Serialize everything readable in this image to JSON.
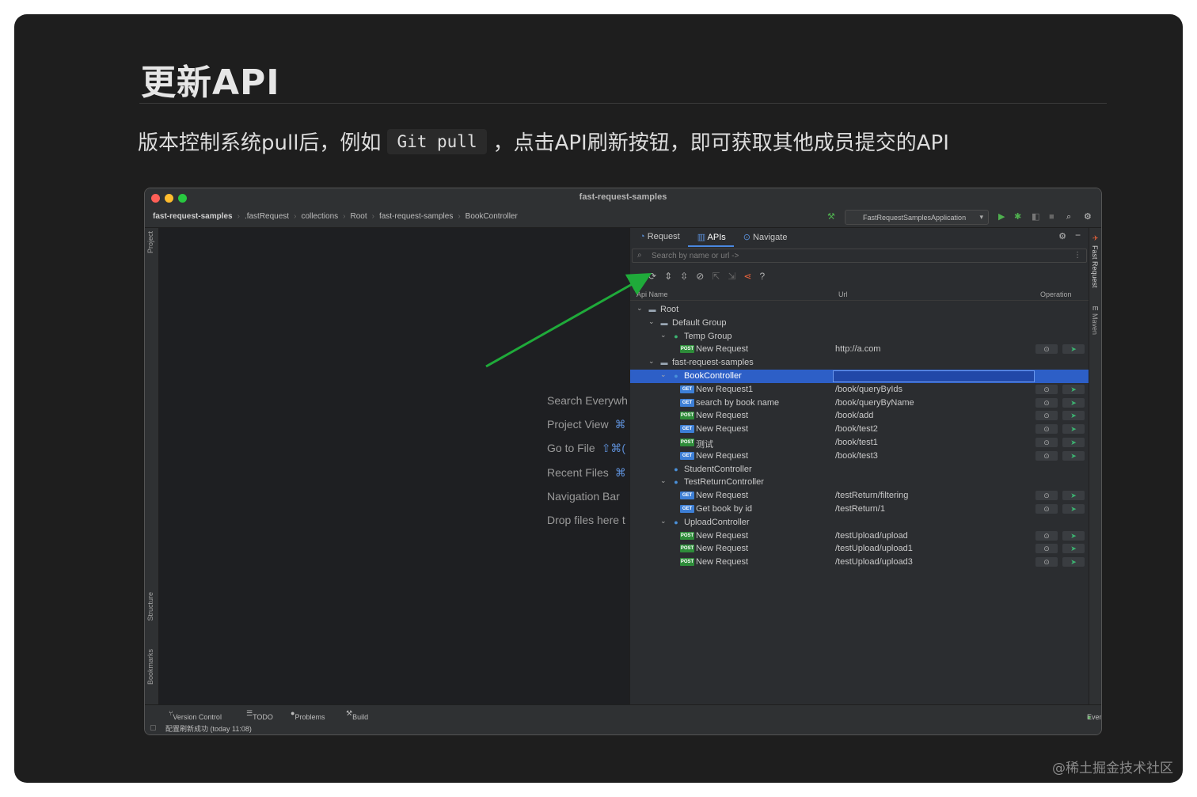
{
  "slide": {
    "title": "更新API",
    "subtitle_before": "版本控制系统pull后，例如",
    "subtitle_code": "Git pull",
    "subtitle_after": "，点击API刷新按钮，即可获取其他成员提交的API",
    "watermark": "@稀土掘金技术社区"
  },
  "ide": {
    "window_title": "fast-request-samples",
    "breadcrumb": [
      "fast-request-samples",
      ".fastRequest",
      "collections",
      "Root",
      "fast-request-samples",
      "BookController"
    ],
    "run_config": "FastRequestSamplesApplication",
    "left_strip": {
      "project": "Project",
      "structure": "Structure",
      "bookmarks": "Bookmarks"
    },
    "right_strip": {
      "fast_request": "Fast Request",
      "maven": "Maven"
    },
    "editor_hints": [
      {
        "label": "Search Everywh",
        "key": ""
      },
      {
        "label": "Project View",
        "key": "⌘"
      },
      {
        "label": "Go to File",
        "key": "⇧⌘("
      },
      {
        "label": "Recent Files",
        "key": "⌘"
      },
      {
        "label": "Navigation Bar",
        "key": ""
      },
      {
        "label": "Drop files here t",
        "key": ""
      }
    ],
    "panel": {
      "tabs": [
        "Request",
        "APIs",
        "Navigate"
      ],
      "active_tab": "APIs",
      "search_placeholder": "Search by name or url ->",
      "columns": {
        "name": "Api Name",
        "url": "Url",
        "operation": "Operation"
      },
      "toolbar_icons": [
        "collapse-icon",
        "refresh-icon",
        "expand-all-icon",
        "collapse-all-icon",
        "disable-icon",
        "export-icon",
        "import-icon",
        "share-icon",
        "help-icon"
      ],
      "tree": [
        {
          "depth": 0,
          "caret": true,
          "icon": "folder",
          "name": "Root",
          "url": ""
        },
        {
          "depth": 1,
          "caret": true,
          "icon": "folder",
          "name": "Default Group",
          "url": ""
        },
        {
          "depth": 2,
          "caret": true,
          "icon": "group",
          "name": "Temp Group",
          "url": ""
        },
        {
          "depth": 3,
          "caret": false,
          "icon": "post",
          "name": "New Request",
          "url": "http://a.com"
        },
        {
          "depth": 1,
          "caret": true,
          "icon": "module",
          "name": "fast-request-samples",
          "url": ""
        },
        {
          "depth": 2,
          "caret": true,
          "icon": "controller",
          "name": "BookController",
          "url": "",
          "selected": true
        },
        {
          "depth": 3,
          "caret": false,
          "icon": "get",
          "name": "New Request1",
          "url": "/book/queryByIds"
        },
        {
          "depth": 3,
          "caret": false,
          "icon": "get",
          "name": "search by book name",
          "url": "/book/queryByName"
        },
        {
          "depth": 3,
          "caret": false,
          "icon": "post",
          "name": "New Request",
          "url": "/book/add"
        },
        {
          "depth": 3,
          "caret": false,
          "icon": "get",
          "name": "New Request",
          "url": "/book/test2"
        },
        {
          "depth": 3,
          "caret": false,
          "icon": "post",
          "name": "测试",
          "url": "/book/test1"
        },
        {
          "depth": 3,
          "caret": false,
          "icon": "get",
          "name": "New Request",
          "url": "/book/test3"
        },
        {
          "depth": 2,
          "caret": false,
          "icon": "controller",
          "name": "StudentController",
          "url": ""
        },
        {
          "depth": 2,
          "caret": true,
          "icon": "controller",
          "name": "TestReturnController",
          "url": ""
        },
        {
          "depth": 3,
          "caret": false,
          "icon": "get",
          "name": "New Request",
          "url": "/testReturn/filtering"
        },
        {
          "depth": 3,
          "caret": false,
          "icon": "get",
          "name": "Get book by id",
          "url": "/testReturn/1"
        },
        {
          "depth": 2,
          "caret": true,
          "icon": "controller",
          "name": "UploadController",
          "url": ""
        },
        {
          "depth": 3,
          "caret": false,
          "icon": "post",
          "name": "New Request",
          "url": "/testUpload/upload"
        },
        {
          "depth": 3,
          "caret": false,
          "icon": "post",
          "name": "New Request",
          "url": "/testUpload/upload1"
        },
        {
          "depth": 3,
          "caret": false,
          "icon": "post",
          "name": "New Request",
          "url": "/testUpload/upload3"
        }
      ],
      "badge_labels": {
        "get": "GET",
        "post": "POST"
      }
    },
    "bottom_tabs": {
      "version_control": "Version Control",
      "todo": "TODO",
      "problems": "Problems",
      "build": "Build",
      "event_log": "Event Log"
    },
    "status_text": "配置刷新成功 (today 11:08)",
    "colors": {
      "accent": "#4a88e0",
      "selection": "#2d5fc7",
      "arrow": "#1faa3a",
      "get_badge": "#3d7fd6",
      "post_badge": "#2e8c3a"
    }
  }
}
